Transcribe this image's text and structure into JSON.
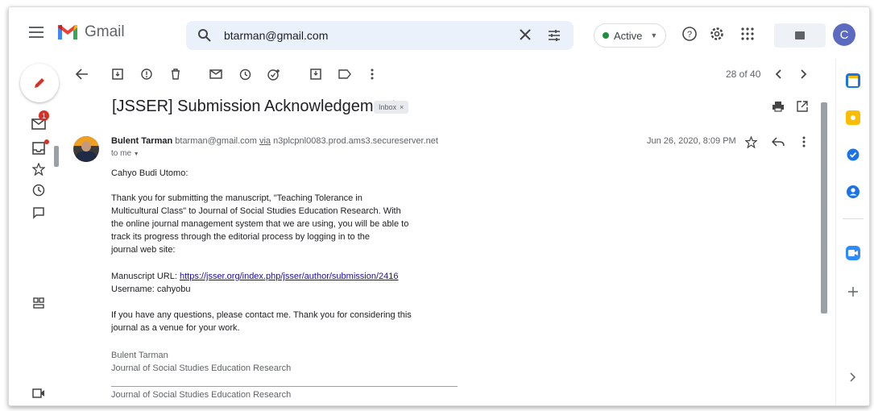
{
  "header": {
    "app_name": "Gmail",
    "search_query": "btarman@gmail.com",
    "status": "Active",
    "avatar_initial": "C"
  },
  "left_rail": {
    "inbox_badge": "1"
  },
  "toolbar": {
    "count": "28 of 40"
  },
  "message": {
    "subject": "[JSSER] Submission Acknowledgement",
    "label_chip": "Inbox",
    "label_close": "×",
    "sender_name": "Bulent Tarman",
    "sender_email": "btarman@gmail.com",
    "via_word": "via",
    "via_server": "n3plcpnl0083.prod.ams3.secureserver.net",
    "to": "to me",
    "date": "Jun 26, 2020, 8:09 PM",
    "greeting": "Cahyo Budi Utomo:",
    "paragraph1": [
      "Thank you for submitting the manuscript, \"Teaching Tolerance in",
      "Multicultural Class\" to Journal of Social Studies Education Research. With",
      "the online journal management system that we are using, you will be able to",
      "track its progress through the editorial process by logging in to the",
      "journal web site:"
    ],
    "manuscript_label": "Manuscript URL: ",
    "manuscript_url": "https://jsser.org/index.php/jsser/author/submission/2416",
    "username_line": "Username: cahyobu",
    "paragraph2": [
      "If you have any questions, please contact me. Thank you for considering this",
      "journal as a venue for your work."
    ],
    "signature": [
      "Bulent Tarman",
      "Journal of Social Studies Education Research"
    ],
    "footer_line": "Journal of Social Studies Education Research"
  },
  "colors": {
    "accent_red": "#d93025",
    "active_green": "#1e8e3e",
    "link_blue": "#1a0dab"
  },
  "icons": [
    "menu-icon",
    "gmail-logo",
    "search-icon",
    "clear-icon",
    "tune-icon",
    "help-icon",
    "settings-icon",
    "apps-icon",
    "compose-icon",
    "mail-icon",
    "inbox-icon",
    "star-icon",
    "clock-icon",
    "chat-icon",
    "spaces-icon",
    "meet-icon",
    "back-icon",
    "archive-icon",
    "report-spam-icon",
    "delete-icon",
    "mark-unread-icon",
    "snooze-icon",
    "add-task-icon",
    "move-to-icon",
    "label-icon",
    "more-icon",
    "prev-icon",
    "next-icon",
    "print-icon",
    "open-new-window-icon",
    "reply-icon",
    "calendar-icon",
    "keep-icon",
    "tasks-icon",
    "contacts-icon",
    "zoom-icon",
    "add-icon",
    "expand-panel-icon"
  ]
}
